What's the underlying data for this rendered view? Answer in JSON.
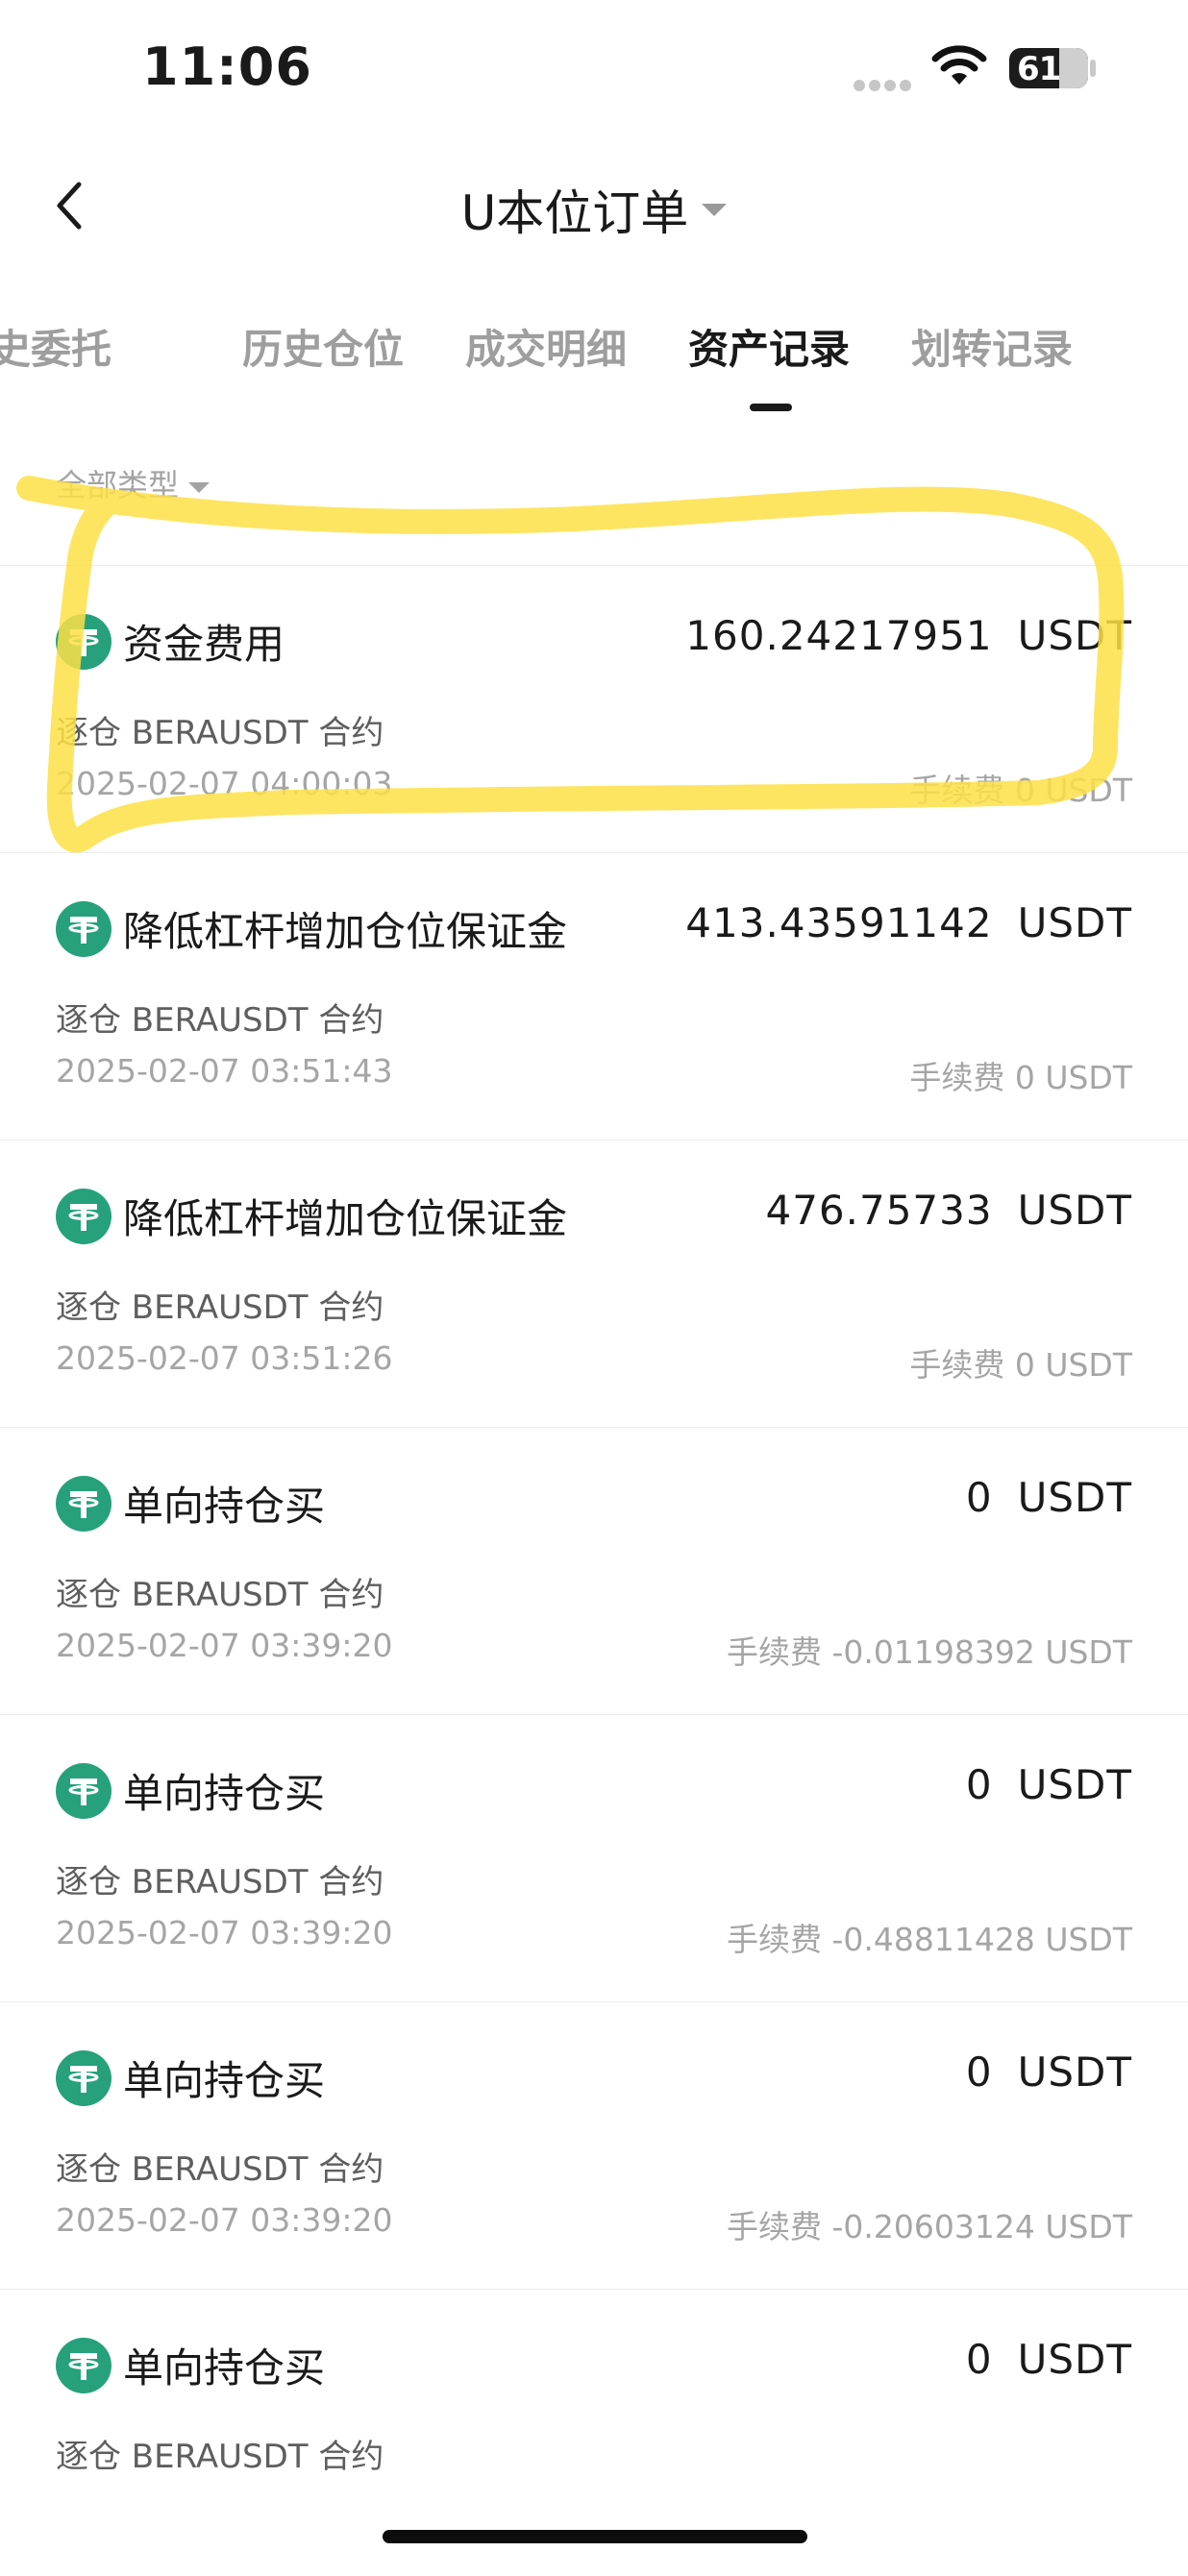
{
  "status_bar": {
    "time": "11:06",
    "battery": "61"
  },
  "header": {
    "title": "U本位订单"
  },
  "tabs": [
    {
      "label": "历史委托"
    },
    {
      "label": "历史仓位"
    },
    {
      "label": "成交明细"
    },
    {
      "label": "资产记录"
    },
    {
      "label": "划转记录"
    }
  ],
  "active_tab": "资产记录",
  "filter": {
    "label": "全部类型"
  },
  "records": [
    {
      "type": "资金费用",
      "amount": "160.24217951",
      "unit": "USDT",
      "contract": "逐仓 BERAUSDT 合约",
      "time": "2025-02-07 04:00:03",
      "fee": "手续费 0 USDT"
    },
    {
      "type": "降低杠杆增加仓位保证金",
      "amount": "413.43591142",
      "unit": "USDT",
      "contract": "逐仓 BERAUSDT 合约",
      "time": "2025-02-07 03:51:43",
      "fee": "手续费 0 USDT"
    },
    {
      "type": "降低杠杆增加仓位保证金",
      "amount": "476.75733",
      "unit": "USDT",
      "contract": "逐仓 BERAUSDT 合约",
      "time": "2025-02-07 03:51:26",
      "fee": "手续费 0 USDT"
    },
    {
      "type": "单向持仓买",
      "amount": "0",
      "unit": "USDT",
      "contract": "逐仓 BERAUSDT 合约",
      "time": "2025-02-07 03:39:20",
      "fee": "手续费 -0.01198392 USDT"
    },
    {
      "type": "单向持仓买",
      "amount": "0",
      "unit": "USDT",
      "contract": "逐仓 BERAUSDT 合约",
      "time": "2025-02-07 03:39:20",
      "fee": "手续费 -0.48811428 USDT"
    },
    {
      "type": "单向持仓买",
      "amount": "0",
      "unit": "USDT",
      "contract": "逐仓 BERAUSDT 合约",
      "time": "2025-02-07 03:39:20",
      "fee": "手续费 -0.20603124 USDT"
    },
    {
      "type": "单向持仓买",
      "amount": "0",
      "unit": "USDT",
      "contract": "逐仓 BERAUSDT 合约",
      "time": "",
      "fee": ""
    }
  ],
  "colors": {
    "usdt_green": "#26a17b",
    "highlight_yellow": "#fde047"
  },
  "icons": {
    "back": "chevron-left-icon",
    "coin": "usdt-icon"
  }
}
